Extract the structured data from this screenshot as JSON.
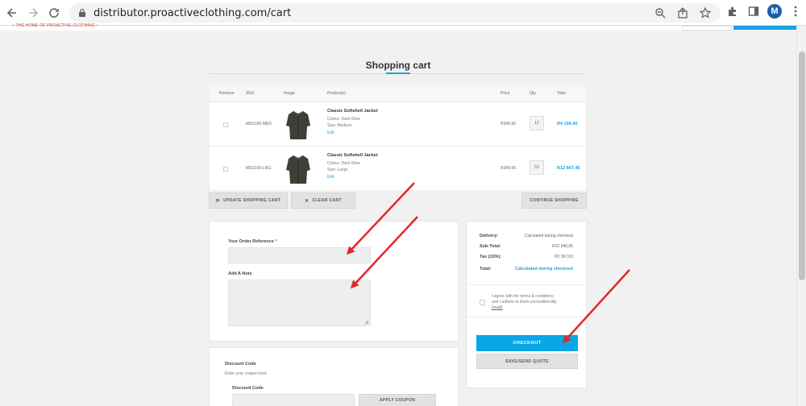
{
  "browser": {
    "url": "distributor.proactiveclothing.com/cart",
    "profile_initial": "M"
  },
  "site": {
    "tagline": "~ THE HOME OF PROACTIVE CLOTHING ~"
  },
  "cart": {
    "title": "Shopping cart",
    "headers": {
      "remove": "Remove",
      "sku": "SKU",
      "image": "Image",
      "products": "Product(s)",
      "price": "Price",
      "qty": "Qty.",
      "total": "Total"
    },
    "rows": [
      {
        "sku": "MSS100-MED",
        "name": "Classic Softshell Jacket",
        "colour": "Colour: Dark Olive",
        "size": "Size: Medium",
        "edit": "Edit",
        "price": "R349,95",
        "qty": "12",
        "total": "R4 199,40"
      },
      {
        "sku": "MSS100-LRG",
        "name": "Classic Softshell Jacket",
        "colour": "Colour: Dark Olive",
        "size": "Size: Large",
        "edit": "Edit",
        "price": "R349,95",
        "qty": "53",
        "total": "R12 847,45"
      }
    ],
    "update_label": "UPDATE SHOPPING CART",
    "clear_label": "CLEAR CART",
    "continue_label": "CONTINUE SHOPPING"
  },
  "order_form": {
    "reference_label": "Your Order Reference",
    "required_mark": "*",
    "note_label": "Add A Note"
  },
  "summary": {
    "delivery_label": "Delivery:",
    "delivery_value": "Calculated during checkout",
    "subtotal_label": "Sub-Total:",
    "subtotal_value": "R22 846,85",
    "tax_label": "Tax (15%):",
    "tax_value": "R3 367,03",
    "total_label": "Total:",
    "total_value": "Calculated during checkout",
    "terms_line1": "I agree with the terms & conditions",
    "terms_line2": "and I adhere to them unconditionally",
    "terms_read": "(read)",
    "checkout_label": "CHECKOUT",
    "quote_label": "SAVE/SEND QUOTE"
  },
  "discount": {
    "title": "Discount Code",
    "subtitle": "Enter your coupon here",
    "field_label": "Discount Code",
    "apply_label": "APPLY COUPON"
  },
  "colors": {
    "accent": "#0aa6e6",
    "annotation_arrow": "#e3262b"
  }
}
